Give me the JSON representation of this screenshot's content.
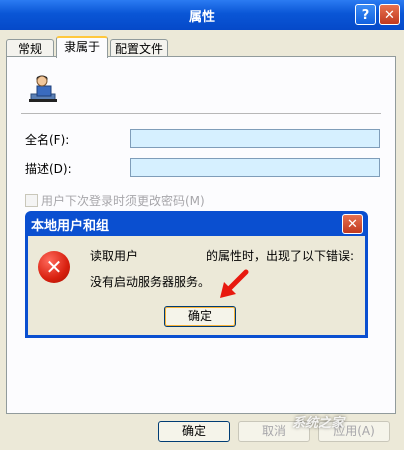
{
  "window": {
    "title": "属性",
    "help_glyph": "?",
    "close_glyph": "✕"
  },
  "tabs": [
    {
      "label": "常规",
      "active": false
    },
    {
      "label": "隶属于",
      "active": true
    },
    {
      "label": "配置文件",
      "active": false
    }
  ],
  "form": {
    "fullname_label": "全名(F):",
    "description_label": "描述(D):",
    "fullname_value": "",
    "description_value": "",
    "checkbox_label": "用户下次登录时须更改密码(M)"
  },
  "error_dialog": {
    "title": "本地用户和组",
    "close_glyph": "✕",
    "message_part1": "读取用户",
    "message_part2": "的属性时，出现了以下错误:",
    "message_line2": "没有启动服务器服务。",
    "ok_label": "确定"
  },
  "buttons": {
    "ok": "确定",
    "cancel": "取消",
    "apply": "应用(A)"
  },
  "watermark": "系统之家",
  "colors": {
    "titlebar": "#0A56D6",
    "input_bg": "#D6F0FF",
    "arrow": "#E8190F",
    "error_red": "#D8200F"
  }
}
